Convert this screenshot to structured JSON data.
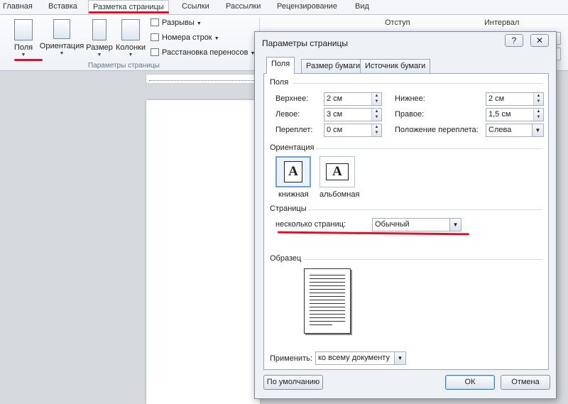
{
  "ribbon": {
    "tabs": [
      "Главная",
      "Вставка",
      "Разметка страницы",
      "Ссылки",
      "Рассылки",
      "Рецензирование",
      "Вид"
    ],
    "buttons": {
      "fields": "Поля",
      "orientation": "Ориентация",
      "size": "Размер",
      "columns": "Колонки"
    },
    "small": {
      "breaks": "Разрывы",
      "line_numbers": "Номера строк",
      "hyphenation": "Расстановка переносов"
    },
    "group_label": "Параметры страницы",
    "indent_label": "Отступ",
    "interval_label": "Интервал"
  },
  "dialog": {
    "title": "Параметры страницы",
    "help_label": "?",
    "close_label": "✕",
    "tabs": [
      "Поля",
      "Размер бумаги",
      "Источник бумаги"
    ],
    "margins": {
      "section": "Поля",
      "top_label": "Верхнее:",
      "top_value": "2 см",
      "bottom_label": "Нижнее:",
      "bottom_value": "2 см",
      "left_label": "Левое:",
      "left_value": "3 см",
      "right_label": "Правое:",
      "right_value": "1,5 см",
      "gutter_label": "Переплет:",
      "gutter_value": "0 см",
      "gutter_pos_label": "Положение переплета:",
      "gutter_pos_value": "Слева"
    },
    "orientation": {
      "section": "Ориентация",
      "portrait": "книжная",
      "landscape": "альбомная",
      "glyph": "A"
    },
    "pages": {
      "section": "Страницы",
      "multiple_label": "несколько страниц:",
      "multiple_value": "Обычный"
    },
    "preview": {
      "section": "Образец"
    },
    "apply": {
      "label": "Применить:",
      "value": "ко всему документу"
    },
    "buttons": {
      "default": "По умолчанию",
      "ok": "ОК",
      "cancel": "Отмена"
    }
  },
  "colors": {
    "annotation_red": "#e0102a",
    "selection_blue": "#6fa3d8"
  }
}
